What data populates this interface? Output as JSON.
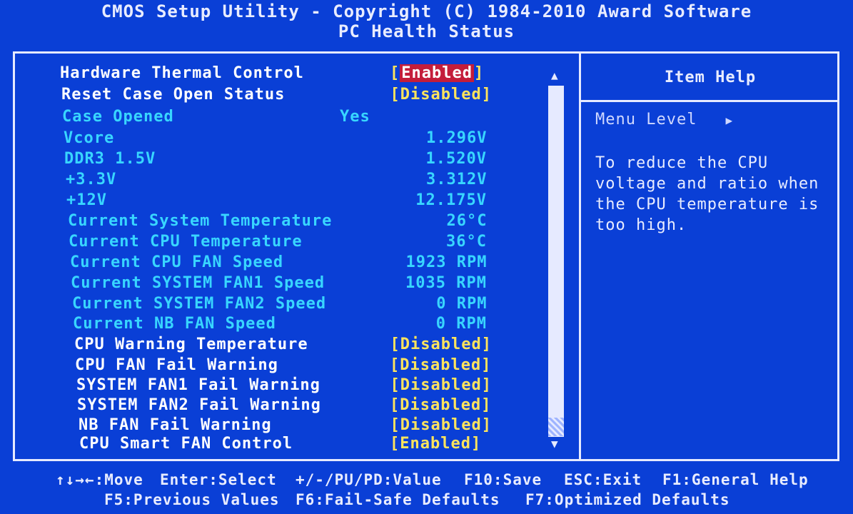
{
  "header": {
    "title": "CMOS Setup Utility - Copyright (C) 1984-2010 Award Software",
    "subtitle": "PC Health Status"
  },
  "items": [
    {
      "label": "Hardware Thermal Control",
      "value": "Enabled",
      "kind": "option",
      "selected": true
    },
    {
      "label": "Reset Case Open Status",
      "value": "Disabled",
      "kind": "option"
    },
    {
      "label": "Case Opened",
      "value": "Yes",
      "kind": "info"
    },
    {
      "label": "Vcore",
      "value": "1.296V",
      "kind": "info"
    },
    {
      "label": "DDR3 1.5V",
      "value": "1.520V",
      "kind": "info"
    },
    {
      "label": "+3.3V",
      "value": "3.312V",
      "kind": "info"
    },
    {
      "label": "+12V",
      "value": "12.175V",
      "kind": "info"
    },
    {
      "label": "Current System Temperature",
      "value": "26°C",
      "kind": "info"
    },
    {
      "label": "Current CPU Temperature",
      "value": "36°C",
      "kind": "info"
    },
    {
      "label": "Current CPU FAN Speed",
      "value": "1923 RPM",
      "kind": "info"
    },
    {
      "label": "Current SYSTEM FAN1 Speed",
      "value": "1035 RPM",
      "kind": "info"
    },
    {
      "label": "Current SYSTEM FAN2 Speed",
      "value": "0 RPM",
      "kind": "info"
    },
    {
      "label": "Current NB FAN Speed",
      "value": "0 RPM",
      "kind": "info"
    },
    {
      "label": "CPU Warning Temperature",
      "value": "Disabled",
      "kind": "option"
    },
    {
      "label": "CPU FAN Fail Warning",
      "value": "Disabled",
      "kind": "option"
    },
    {
      "label": "SYSTEM FAN1 Fail Warning",
      "value": "Disabled",
      "kind": "option"
    },
    {
      "label": "SYSTEM FAN2 Fail Warning",
      "value": "Disabled",
      "kind": "option"
    },
    {
      "label": "NB FAN Fail Warning",
      "value": "Disabled",
      "kind": "option"
    },
    {
      "label": "CPU Smart FAN Control",
      "value": "Enabled",
      "kind": "option"
    }
  ],
  "help": {
    "title": "Item Help",
    "menu_level": "Menu Level",
    "text": "To reduce the CPU voltage and ratio when the CPU temperature is too high."
  },
  "footer": {
    "move": "↑↓→←:Move",
    "enter": "Enter:Select",
    "value": "+/-/PU/PD:Value",
    "f10": "F10:Save",
    "esc": "ESC:Exit",
    "f1": "F1:General Help",
    "f5": "F5:Previous Values",
    "f6": "F6:Fail-Safe Defaults",
    "f7": "F7:Optimized Defaults"
  },
  "colors": {
    "background": "#0a3fd6",
    "setting_text": "#ffffff",
    "info_text": "#38d6ff",
    "option_text": "#ffe45c",
    "highlight": "#c41d3b"
  }
}
